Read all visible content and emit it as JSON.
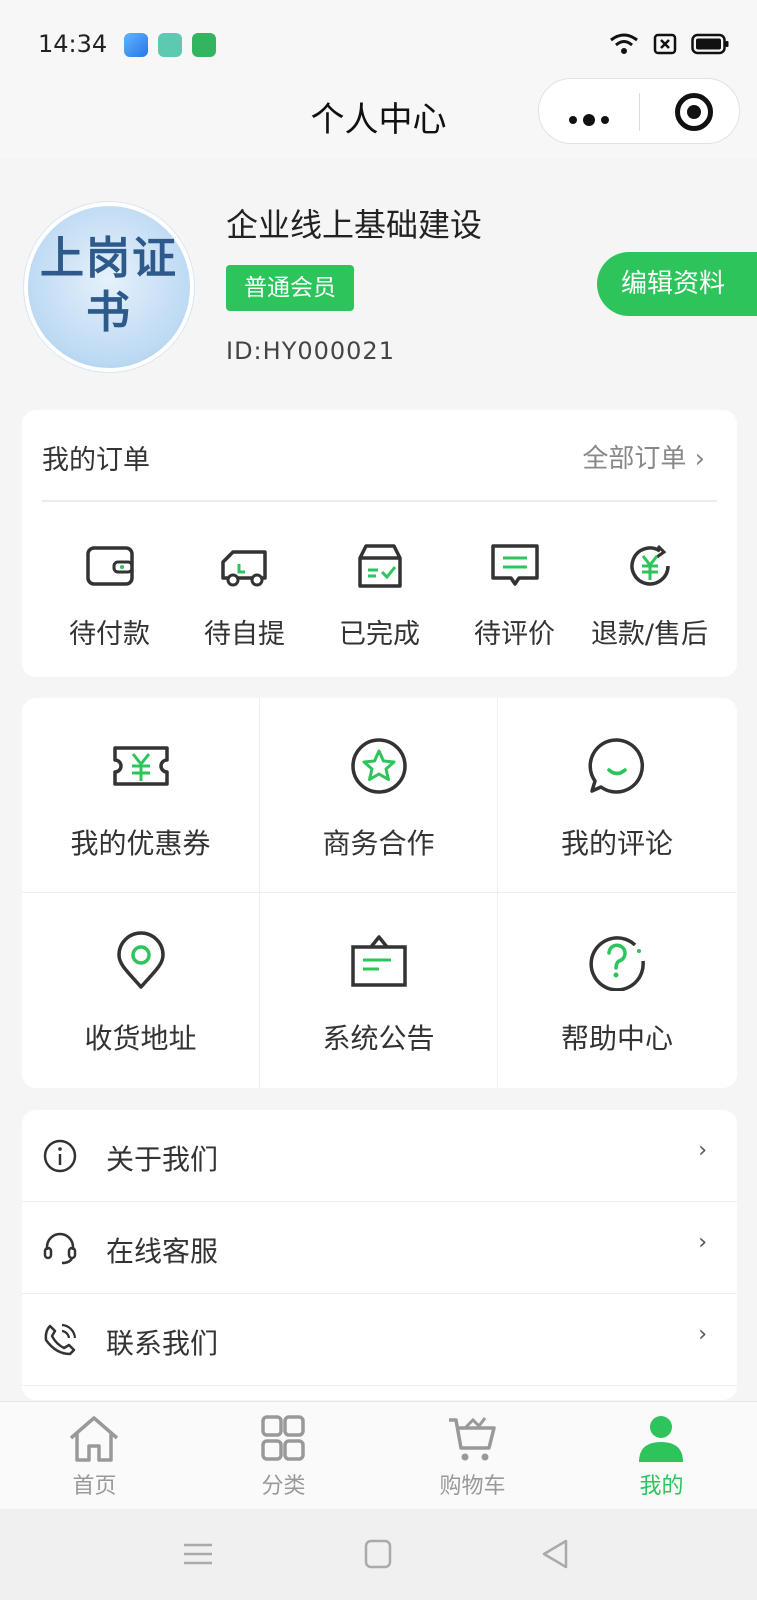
{
  "status_bar": {
    "time": "14:34"
  },
  "nav": {
    "title": "个人中心"
  },
  "profile": {
    "avatar_text": "上岗证书",
    "name": "企业线上基础建设",
    "badge": "普通会员",
    "id": "ID:HY000021",
    "edit_label": "编辑资料"
  },
  "orders": {
    "title": "我的订单",
    "all_label": "全部订单 ›",
    "items": [
      {
        "label": "待付款",
        "icon": "wallet-icon"
      },
      {
        "label": "待自提",
        "icon": "truck-icon"
      },
      {
        "label": "已完成",
        "icon": "box-check-icon"
      },
      {
        "label": "待评价",
        "icon": "comment-icon"
      },
      {
        "label": "退款/售后",
        "icon": "refund-icon"
      }
    ]
  },
  "services": [
    {
      "label": "我的优惠券",
      "icon": "coupon-icon"
    },
    {
      "label": "商务合作",
      "icon": "star-icon"
    },
    {
      "label": "我的评论",
      "icon": "chat-bubble-icon"
    },
    {
      "label": "收货地址",
      "icon": "location-pin-icon"
    },
    {
      "label": "系统公告",
      "icon": "notice-board-icon"
    },
    {
      "label": "帮助中心",
      "icon": "help-icon"
    }
  ],
  "menu": [
    {
      "label": "关于我们",
      "icon": "info-icon"
    },
    {
      "label": "在线客服",
      "icon": "headset-icon"
    },
    {
      "label": "联系我们",
      "icon": "phone-icon"
    }
  ],
  "tabbar": [
    {
      "label": "首页",
      "icon": "home-icon"
    },
    {
      "label": "分类",
      "icon": "category-icon"
    },
    {
      "label": "购物车",
      "icon": "cart-icon"
    },
    {
      "label": "我的",
      "icon": "user-icon",
      "active": true
    }
  ],
  "colors": {
    "accent": "#2ec45c",
    "text": "#333333",
    "muted": "#888888"
  }
}
